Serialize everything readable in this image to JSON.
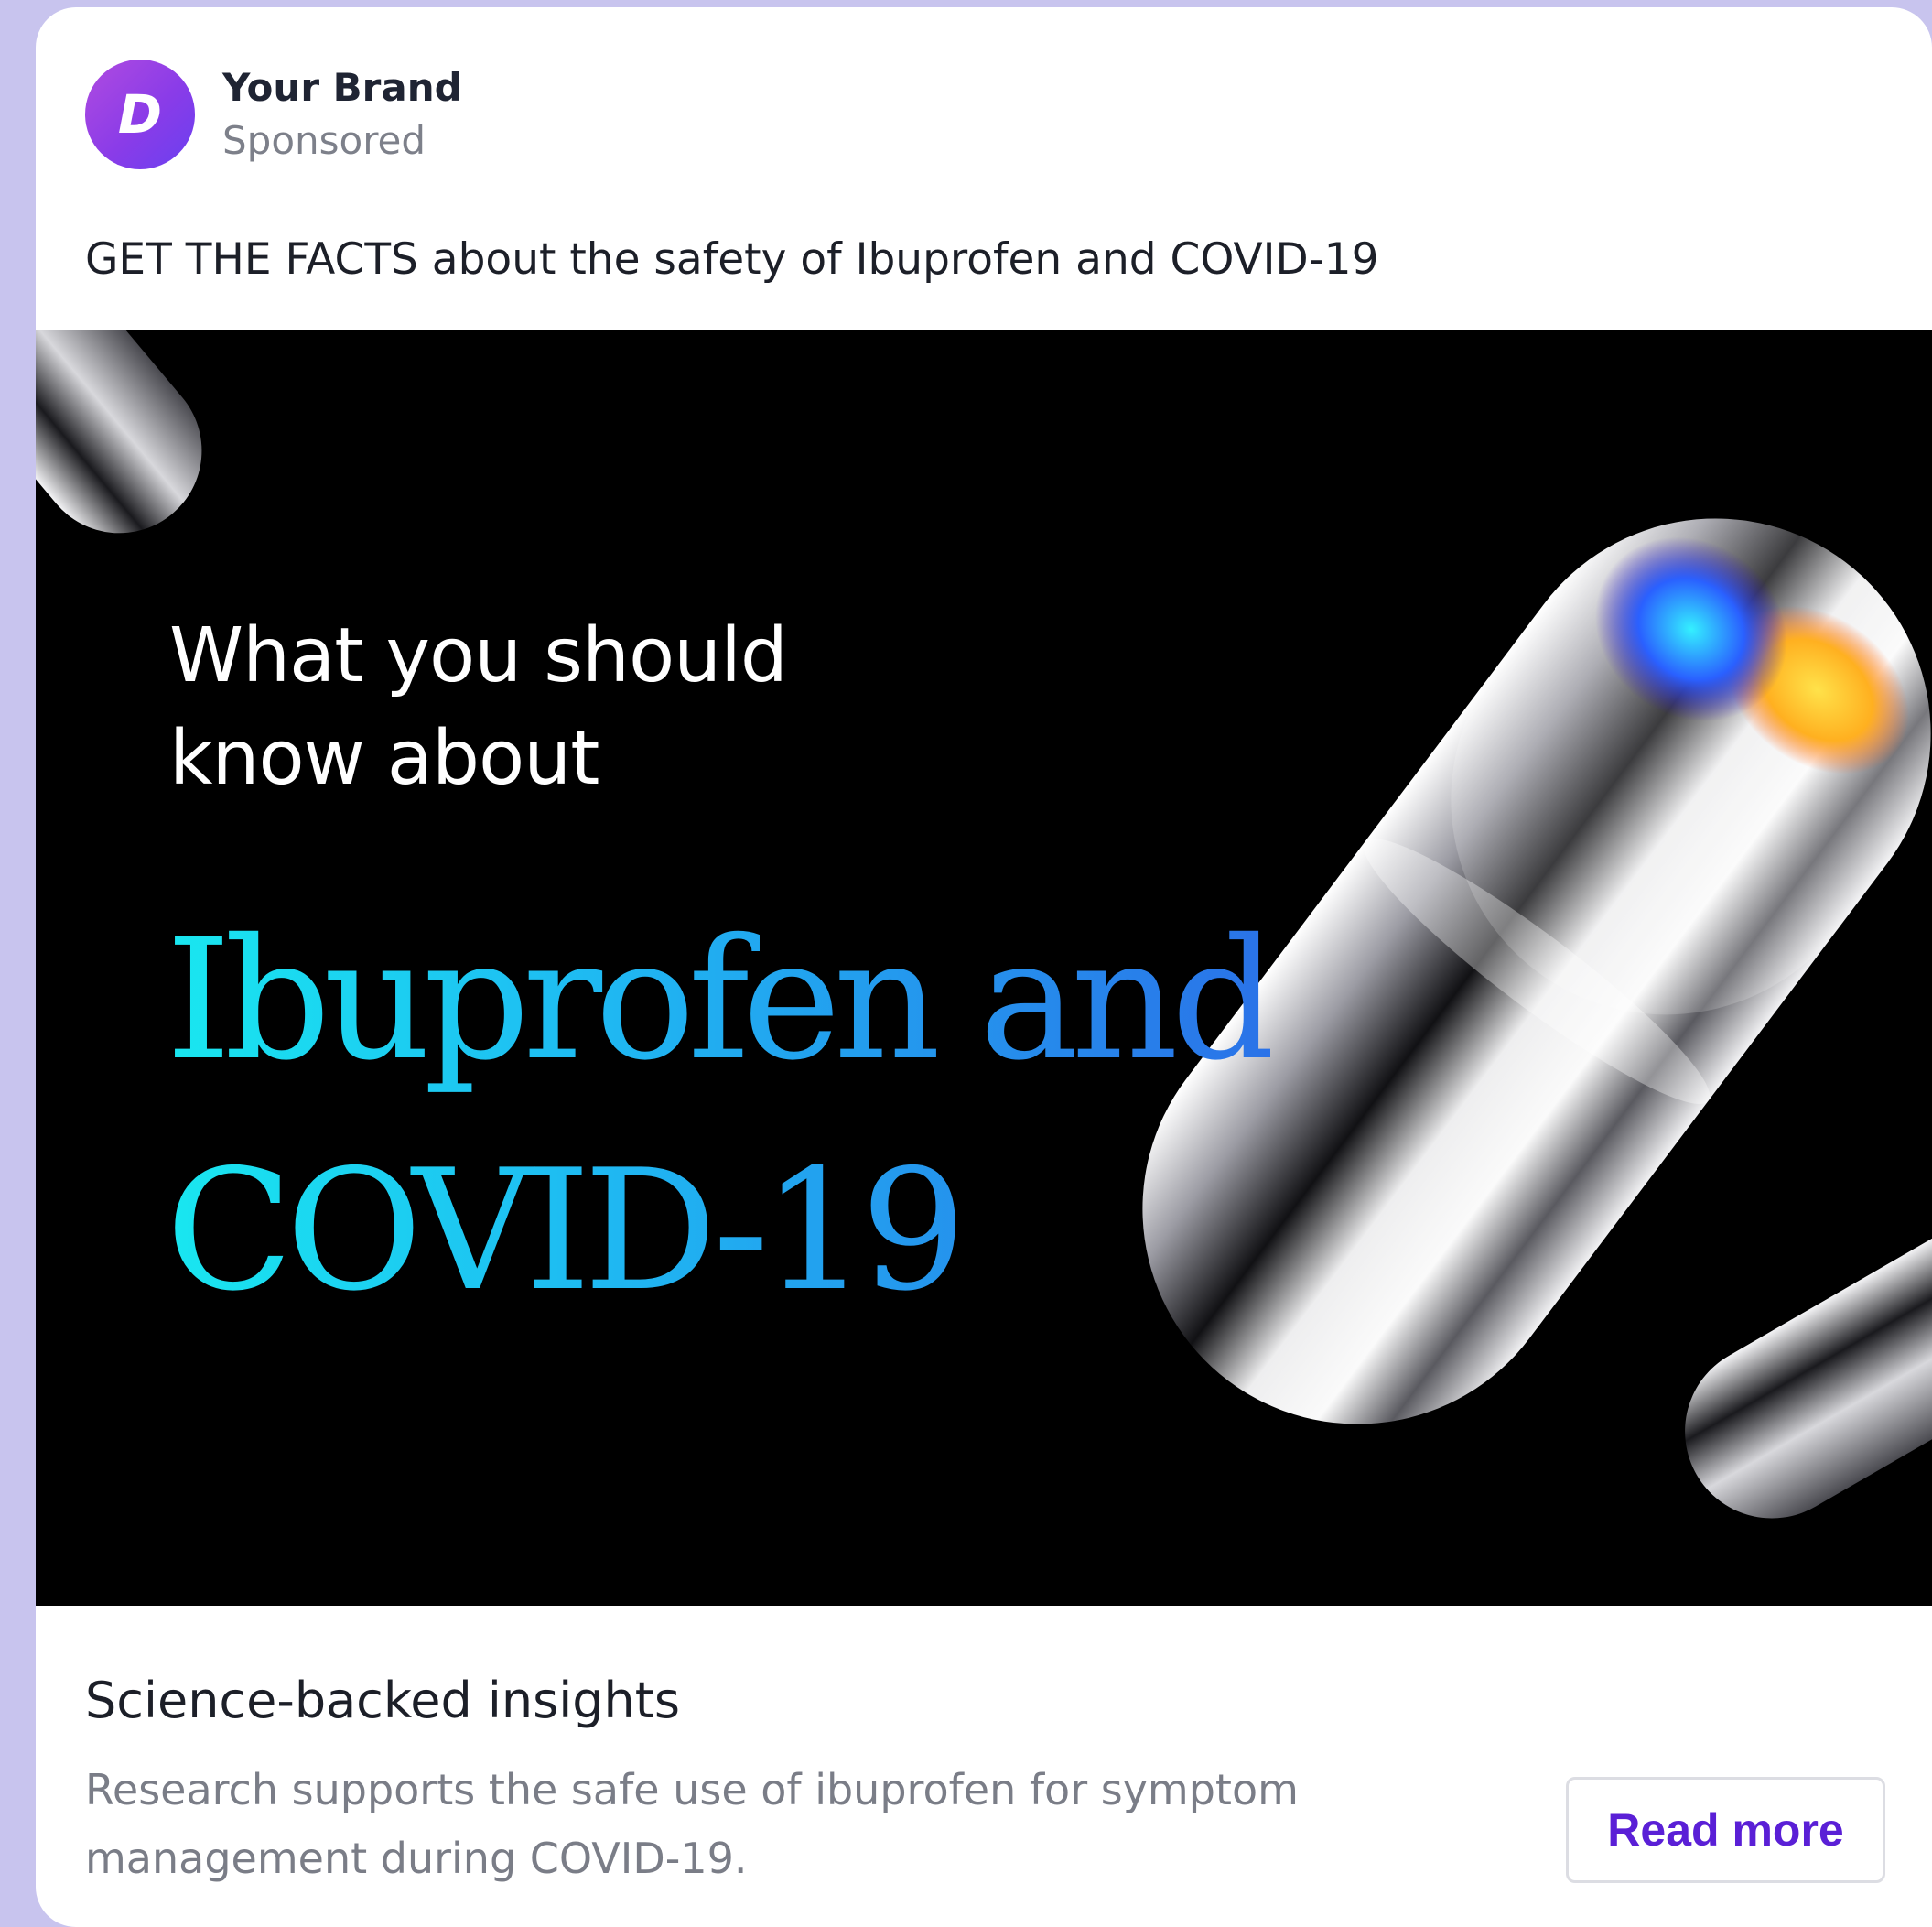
{
  "post": {
    "avatar_letter": "D",
    "brand_name": "Your Brand",
    "sponsored_label": "Sponsored",
    "caption": "GET THE FACTS about the safety of Ibuprofen and COVID-19"
  },
  "media": {
    "lead_line_1": "What you should",
    "lead_line_2": "know about",
    "headline_line_1": "Ibuprofen and",
    "headline_line_2": "COVID-19"
  },
  "footer": {
    "title": "Science-backed insights",
    "description": "Research supports the safe use of ibuprofen for symptom management during COVID-19.",
    "cta_label": "Read more"
  },
  "colors": {
    "page_background": "#c8c4ee",
    "card_background": "#ffffff",
    "brand_accent": "#8a3ce8",
    "cta_text": "#5a1fd6",
    "headline_gradient_start": "#19e7f0",
    "headline_gradient_end": "#2a72e8"
  }
}
